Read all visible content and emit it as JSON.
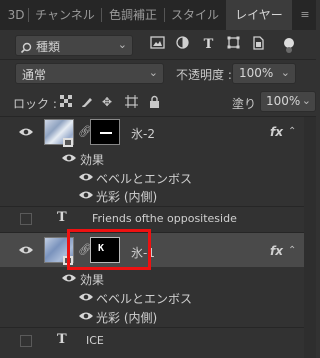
{
  "tabs": [
    "3D",
    "チャンネル",
    "色調補正",
    "スタイル",
    "レイヤー"
  ],
  "filter": {
    "value": "種類"
  },
  "blend_mode": {
    "value": "通常"
  },
  "opacity": {
    "label": "不透明度 :",
    "value": "100%"
  },
  "lock": {
    "label": "ロック :"
  },
  "fill": {
    "label": "塗り :",
    "value": "100%"
  },
  "layers": [
    {
      "name": "氷-2",
      "fx": "fx",
      "effects_label": "効果",
      "effects": [
        "ベベルとエンボス",
        "光彩 (内側)"
      ]
    },
    {
      "name": "Friends ofthe oppositeside"
    },
    {
      "name": "氷-1",
      "fx": "fx",
      "effects_label": "効果",
      "effects": [
        "ベベルとエンボス",
        "光彩 (内側)"
      ]
    },
    {
      "name": "ICE"
    }
  ],
  "mask_text": "K",
  "colors": {
    "highlight": "#ee1111",
    "panel": "#323232"
  }
}
